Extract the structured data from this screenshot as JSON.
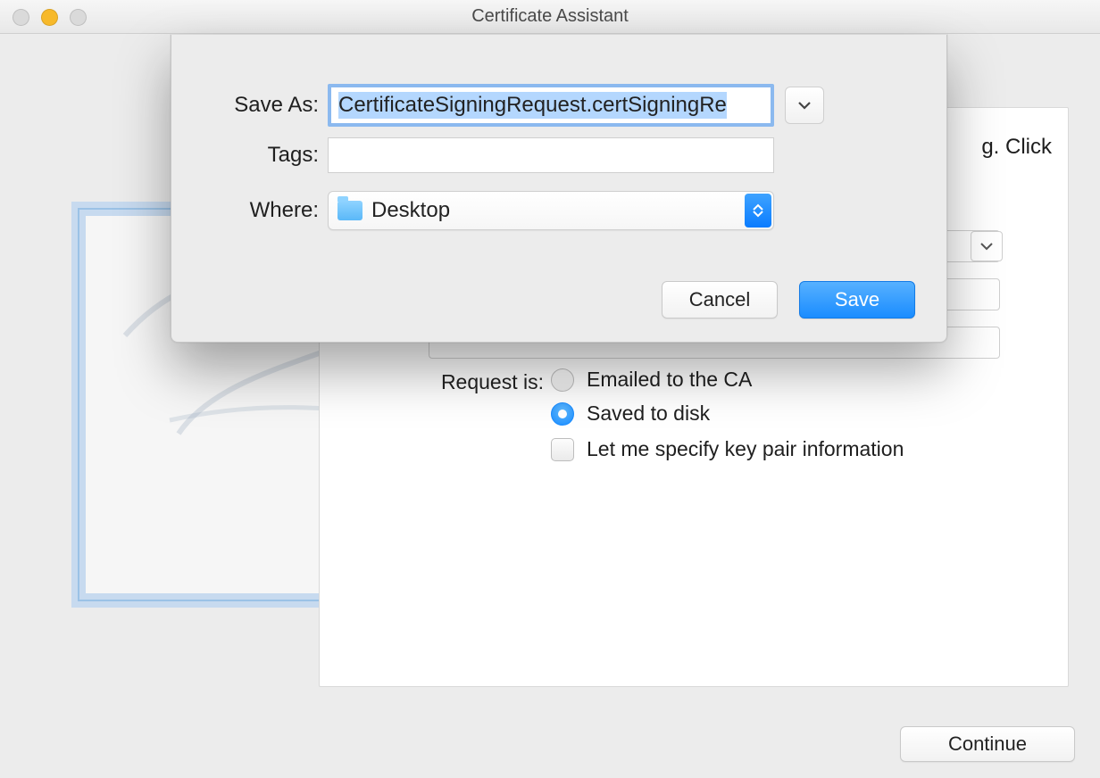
{
  "window": {
    "title": "Certificate Assistant"
  },
  "assistant": {
    "hint_fragment": "g. Click",
    "request_label": "Request is:",
    "options": {
      "emailed": "Emailed to the CA",
      "saved": "Saved to disk",
      "specify_keypair": "Let me specify key pair information"
    },
    "continue": "Continue"
  },
  "save_sheet": {
    "save_as_label": "Save As:",
    "save_as_value": "CertificateSigningRequest.certSigningRe",
    "tags_label": "Tags:",
    "tags_value": "",
    "where_label": "Where:",
    "where_value": "Desktop",
    "cancel": "Cancel",
    "save": "Save"
  }
}
